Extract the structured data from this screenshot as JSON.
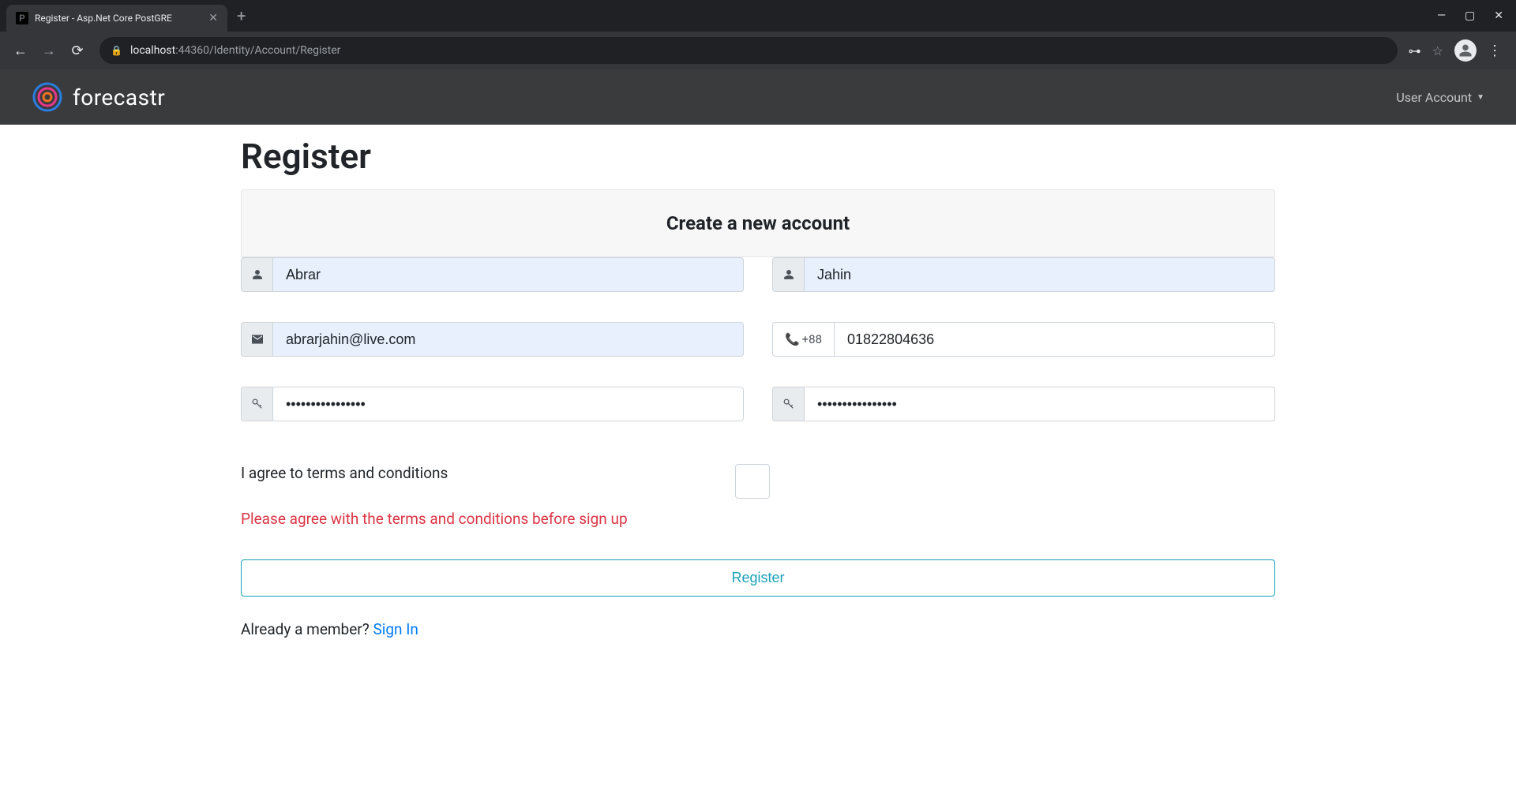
{
  "browser": {
    "tab_title": "Register - Asp.Net Core PostGRE",
    "url_host": "localhost",
    "url_port": ":44360",
    "url_path": "/Identity/Account/Register"
  },
  "header": {
    "brand": "forecastr",
    "user_menu": "User Account"
  },
  "page": {
    "title": "Register",
    "card_title": "Create a new account"
  },
  "form": {
    "first_name": "Abrar",
    "last_name": "Jahin",
    "email": "abrarjahin@live.com",
    "phone_prefix": "+88",
    "phone": "01822804636",
    "password": "••••••••••••••••",
    "confirm_password": "••••••••••••••••",
    "terms_label": "I agree to terms and conditions",
    "terms_error": "Please agree with the terms and conditions before sign up",
    "submit_label": "Register",
    "signin_prompt": "Already a member? ",
    "signin_link": "Sign In"
  }
}
